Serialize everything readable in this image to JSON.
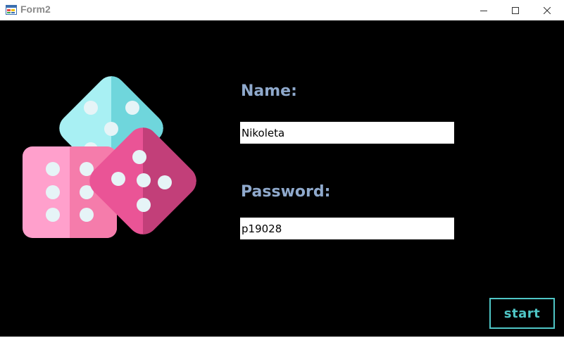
{
  "window": {
    "title": "Form2",
    "icon": "windows-form-icon",
    "controls": [
      "minimize-icon",
      "maximize-icon",
      "close-icon"
    ]
  },
  "form": {
    "name_label": "Name:",
    "name_value": "Nikoleta",
    "password_label": "Password:",
    "password_value": "p19028",
    "start_button": "start"
  },
  "illustration": {
    "icon": "dice-icon",
    "colors": {
      "cyan_light": "#a8f0f3",
      "cyan_dark": "#6fd6dc",
      "pink_light": "#ffa0cc",
      "pink_dark": "#f57cab",
      "magenta_light": "#ea5496",
      "magenta_dark": "#c23f79",
      "pip": "#e6f4f7"
    }
  },
  "colors": {
    "background": "#000000",
    "label": "#8fa9cc",
    "accent": "#4fc6c6"
  }
}
